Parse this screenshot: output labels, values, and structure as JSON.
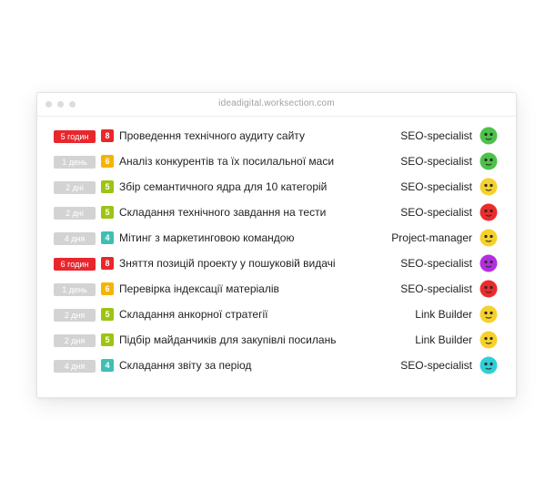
{
  "window": {
    "url": "ideadigital.worksection.com"
  },
  "tasks": [
    {
      "time": "5 годин",
      "time_color": "#e8272d",
      "priority": "8",
      "priority_color": "#e8272d",
      "title": "Проведення технічного аудиту сайту",
      "role": "SEO-specialist",
      "avatar_color": "#4cc24a",
      "avatar_icon": "face-icon"
    },
    {
      "time": "1 день",
      "time_color": "#d3d3d3",
      "priority": "6",
      "priority_color": "#f6b400",
      "title": "Аналіз конкурентів та їх посилальної маси",
      "role": "SEO-specialist",
      "avatar_color": "#4cc24a",
      "avatar_icon": "face-icon"
    },
    {
      "time": "2 дні",
      "time_color": "#d3d3d3",
      "priority": "5",
      "priority_color": "#9cc413",
      "title": "Збір семантичного ядра для 10 категорій",
      "role": "SEO-specialist",
      "avatar_color": "#f6d12b",
      "avatar_icon": "face-icon"
    },
    {
      "time": "2 дні",
      "time_color": "#d3d3d3",
      "priority": "5",
      "priority_color": "#9cc413",
      "title": "Складання технічного завдання на тести",
      "role": "SEO-specialist",
      "avatar_color": "#ec2c2c",
      "avatar_icon": "face-icon"
    },
    {
      "time": "4 дня",
      "time_color": "#d3d3d3",
      "priority": "4",
      "priority_color": "#3fbfb4",
      "title": "Мітинг з маркетинговою командою",
      "role": "Project-manager",
      "avatar_color": "#f6d12b",
      "avatar_icon": "face-icon"
    },
    {
      "time": "6 годин",
      "time_color": "#e8272d",
      "priority": "8",
      "priority_color": "#e8272d",
      "title": "Зняття позицій проекту у пошуковій видачі",
      "role": "SEO-specialist",
      "avatar_color": "#b42ee0",
      "avatar_icon": "face-icon"
    },
    {
      "time": "1 день",
      "time_color": "#d3d3d3",
      "priority": "6",
      "priority_color": "#f6b400",
      "title": "Перевірка індексації матеріалів",
      "role": "SEO-specialist",
      "avatar_color": "#ec2c2c",
      "avatar_icon": "face-icon"
    },
    {
      "time": "2 дня",
      "time_color": "#d3d3d3",
      "priority": "5",
      "priority_color": "#9cc413",
      "title": "Складання анкорної стратегії",
      "role": "Link Builder",
      "avatar_color": "#f6d12b",
      "avatar_icon": "face-icon"
    },
    {
      "time": "2 дня",
      "time_color": "#d3d3d3",
      "priority": "5",
      "priority_color": "#9cc413",
      "title": "Підбір майданчиків для закупівлі посилань",
      "role": "Link Builder",
      "avatar_color": "#f6d12b",
      "avatar_icon": "face-icon"
    },
    {
      "time": "4 дня",
      "time_color": "#d3d3d3",
      "priority": "4",
      "priority_color": "#3fbfb4",
      "title": "Складання звіту за період",
      "role": "SEO-specialist",
      "avatar_color": "#2fcfd8",
      "avatar_icon": "face-icon"
    }
  ]
}
